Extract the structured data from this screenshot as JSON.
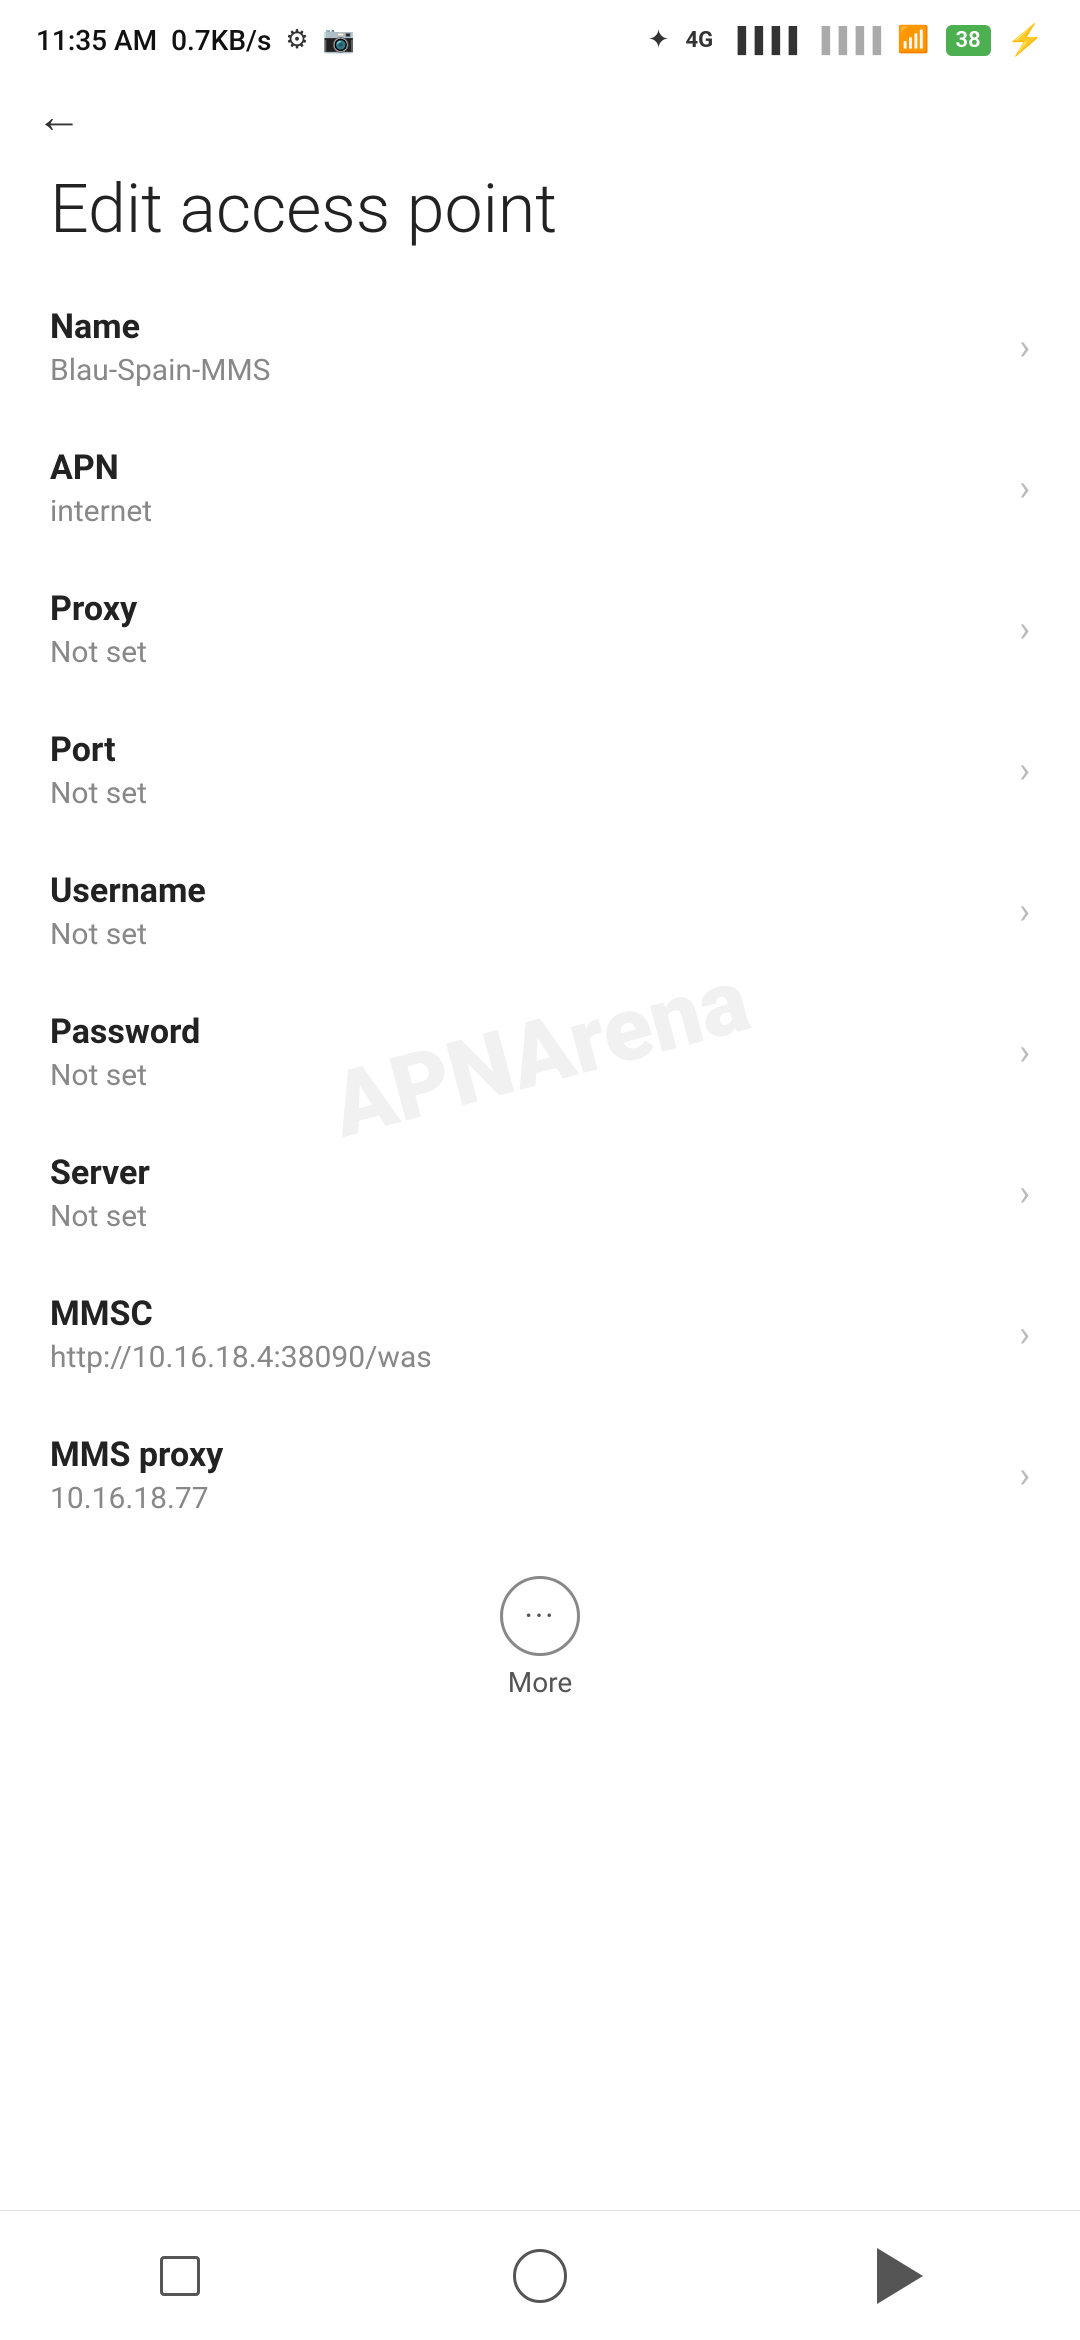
{
  "statusBar": {
    "time": "11:35 AM",
    "speed": "0.7KB/s"
  },
  "toolbar": {
    "backLabel": "←"
  },
  "page": {
    "title": "Edit access point"
  },
  "fields": [
    {
      "label": "Name",
      "value": "Blau-Spain-MMS"
    },
    {
      "label": "APN",
      "value": "internet"
    },
    {
      "label": "Proxy",
      "value": "Not set"
    },
    {
      "label": "Port",
      "value": "Not set"
    },
    {
      "label": "Username",
      "value": "Not set"
    },
    {
      "label": "Password",
      "value": "Not set"
    },
    {
      "label": "Server",
      "value": "Not set"
    },
    {
      "label": "MMSC",
      "value": "http://10.16.18.4:38090/was"
    },
    {
      "label": "MMS proxy",
      "value": "10.16.18.77"
    }
  ],
  "more": {
    "label": "More"
  },
  "watermark": "APNArena"
}
